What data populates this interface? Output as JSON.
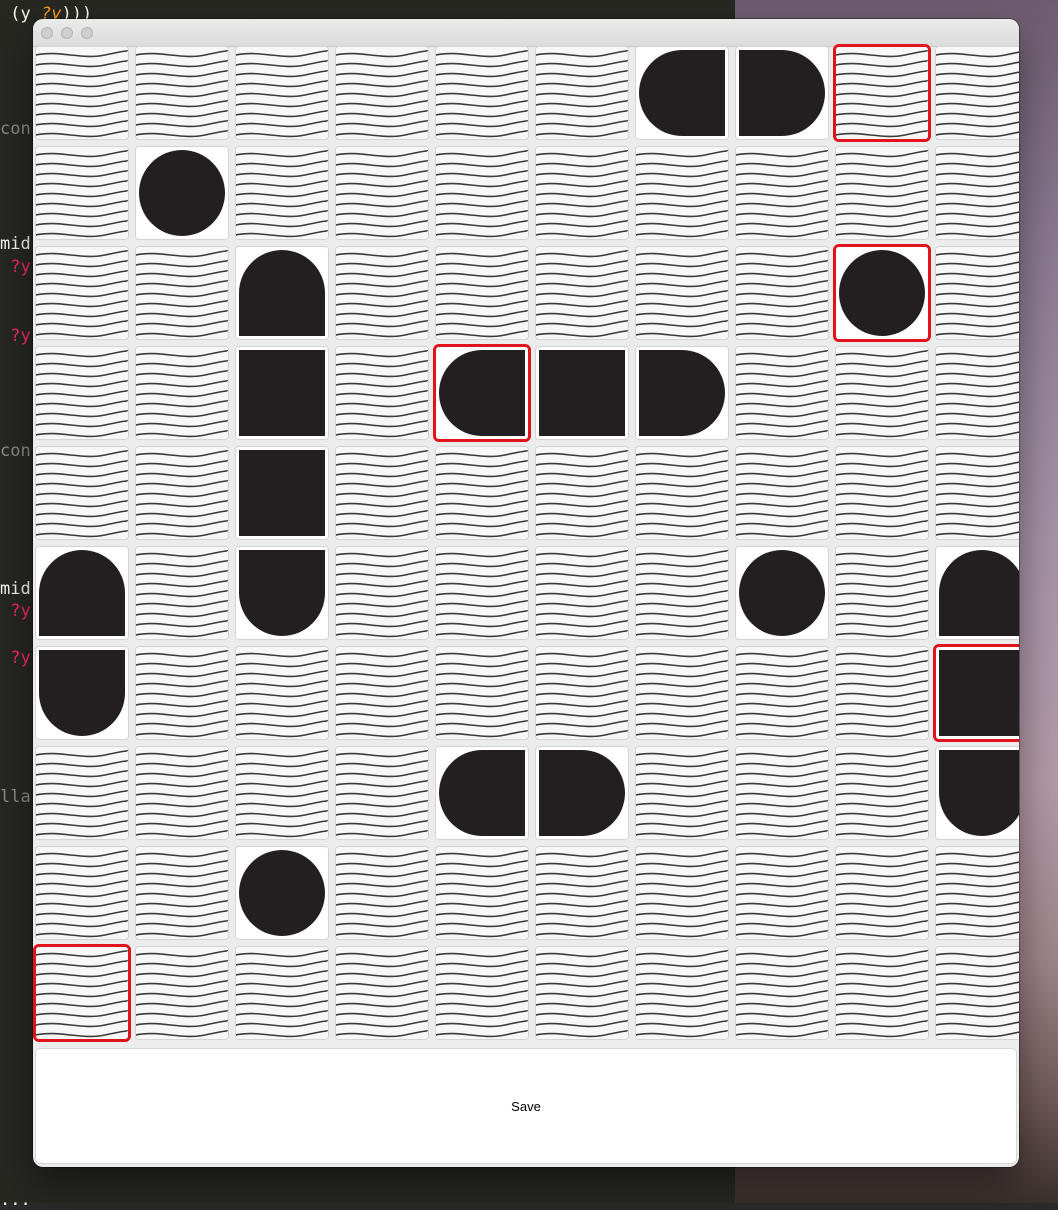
{
  "editor_fragments": [
    {
      "parts": [
        {
          "t": " (y ",
          "c": "c-white"
        },
        {
          "t": "?y",
          "c": "c-orange"
        },
        {
          "t": ")))",
          "c": "c-white"
        }
      ],
      "row": 0
    },
    {
      "parts": [
        {
          "t": "con",
          "c": "c-grey"
        }
      ],
      "row": 1
    },
    {
      "parts": [
        {
          "t": "mid",
          "c": "c-white"
        }
      ],
      "row": 2
    },
    {
      "parts": [
        {
          "t": " ?y",
          "c": "c-pink"
        }
      ],
      "row": 3
    },
    {
      "parts": [
        {
          "t": " ?y",
          "c": "c-pink"
        }
      ],
      "row": 4
    },
    {
      "parts": [
        {
          "t": "con",
          "c": "c-grey"
        }
      ],
      "row": 5
    },
    {
      "parts": [
        {
          "t": "mid",
          "c": "c-white"
        }
      ],
      "row": 6
    },
    {
      "parts": [
        {
          "t": " ?y",
          "c": "c-pink"
        }
      ],
      "row": 7
    },
    {
      "parts": [
        {
          "t": " ?y",
          "c": "c-pink"
        }
      ],
      "row": 8
    },
    {
      "parts": [
        {
          "t": "lla",
          "c": "c-grey"
        }
      ],
      "row": 9
    },
    {
      "parts": [
        {
          "t": "...",
          "c": "c-white"
        }
      ],
      "row": 10
    }
  ],
  "board": {
    "rows": 10,
    "cols": 10,
    "legend": {
      "W": "water",
      "O": "single-circle",
      "L": "round-left-end",
      "R": "round-right-end",
      "T": "round-top-end",
      "B": "round-bottom-end",
      "S": "middle-square"
    },
    "cells": [
      [
        "W",
        "W",
        "W",
        "W",
        "W",
        "W",
        "L",
        "R",
        "W",
        "W"
      ],
      [
        "W",
        "O",
        "W",
        "W",
        "W",
        "W",
        "W",
        "W",
        "W",
        "W"
      ],
      [
        "W",
        "W",
        "T",
        "W",
        "W",
        "W",
        "W",
        "W",
        "O",
        "W"
      ],
      [
        "W",
        "W",
        "S",
        "W",
        "L",
        "S",
        "R",
        "W",
        "W",
        "W"
      ],
      [
        "W",
        "W",
        "S",
        "W",
        "W",
        "W",
        "W",
        "W",
        "W",
        "W"
      ],
      [
        "T",
        "W",
        "B",
        "W",
        "W",
        "W",
        "W",
        "O",
        "W",
        "T"
      ],
      [
        "B",
        "W",
        "W",
        "W",
        "W",
        "W",
        "W",
        "W",
        "W",
        "S"
      ],
      [
        "W",
        "W",
        "W",
        "W",
        "L",
        "R",
        "W",
        "W",
        "W",
        "B"
      ],
      [
        "W",
        "W",
        "O",
        "W",
        "W",
        "W",
        "W",
        "W",
        "W",
        "W"
      ],
      [
        "W",
        "W",
        "W",
        "W",
        "W",
        "W",
        "W",
        "W",
        "W",
        "W"
      ]
    ],
    "selected": [
      [
        0,
        8
      ],
      [
        2,
        8
      ],
      [
        3,
        4
      ],
      [
        6,
        9
      ],
      [
        9,
        0
      ]
    ]
  },
  "save_button": {
    "label": "Save"
  },
  "colors": {
    "ship": "#231f20",
    "water_line": "#3a3a3a",
    "selection": "#e0141c"
  }
}
